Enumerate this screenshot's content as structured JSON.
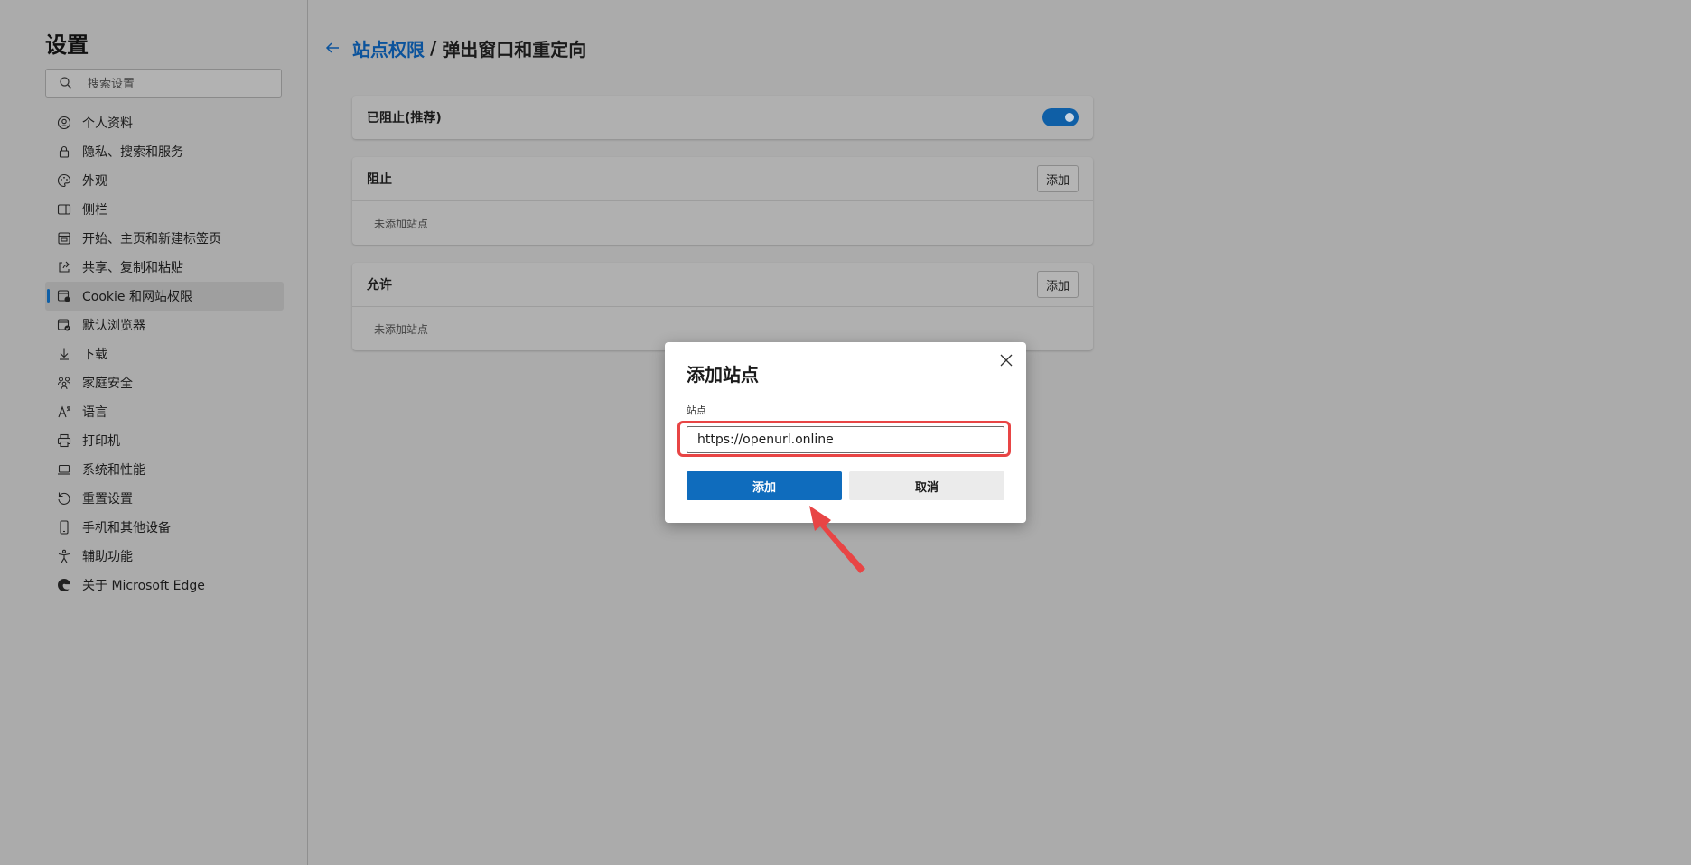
{
  "sidebar": {
    "title": "设置",
    "search_placeholder": "搜索设置",
    "items": [
      {
        "label": "个人资料",
        "icon": "profile-icon"
      },
      {
        "label": "隐私、搜索和服务",
        "icon": "lock-icon"
      },
      {
        "label": "外观",
        "icon": "palette-icon"
      },
      {
        "label": "侧栏",
        "icon": "sidebar-icon"
      },
      {
        "label": "开始、主页和新建标签页",
        "icon": "home-tab-icon"
      },
      {
        "label": "共享、复制和粘贴",
        "icon": "share-icon"
      },
      {
        "label": "Cookie 和网站权限",
        "icon": "cookie-site-icon",
        "active": true
      },
      {
        "label": "默认浏览器",
        "icon": "browser-icon"
      },
      {
        "label": "下载",
        "icon": "download-icon"
      },
      {
        "label": "家庭安全",
        "icon": "family-icon"
      },
      {
        "label": "语言",
        "icon": "language-icon"
      },
      {
        "label": "打印机",
        "icon": "printer-icon"
      },
      {
        "label": "系统和性能",
        "icon": "laptop-icon"
      },
      {
        "label": "重置设置",
        "icon": "reset-icon"
      },
      {
        "label": "手机和其他设备",
        "icon": "phone-icon"
      },
      {
        "label": "辅助功能",
        "icon": "accessibility-icon"
      },
      {
        "label": "关于 Microsoft Edge",
        "icon": "edge-logo-icon"
      }
    ]
  },
  "header": {
    "breadcrumb_link": "站点权限",
    "separator": "/",
    "current": "弹出窗口和重定向"
  },
  "blocked_toggle": {
    "label": "已阻止(推荐)",
    "on": true
  },
  "block_section": {
    "title": "阻止",
    "add_label": "添加",
    "empty": "未添加站点"
  },
  "allow_section": {
    "title": "允许",
    "add_label": "添加",
    "empty": "未添加站点"
  },
  "dialog": {
    "title": "添加站点",
    "field_label": "站点",
    "field_value": "https://openurl.online",
    "add_label": "添加",
    "cancel_label": "取消"
  },
  "colors": {
    "accent": "#0f6cbd",
    "annotation": "#e84545"
  }
}
